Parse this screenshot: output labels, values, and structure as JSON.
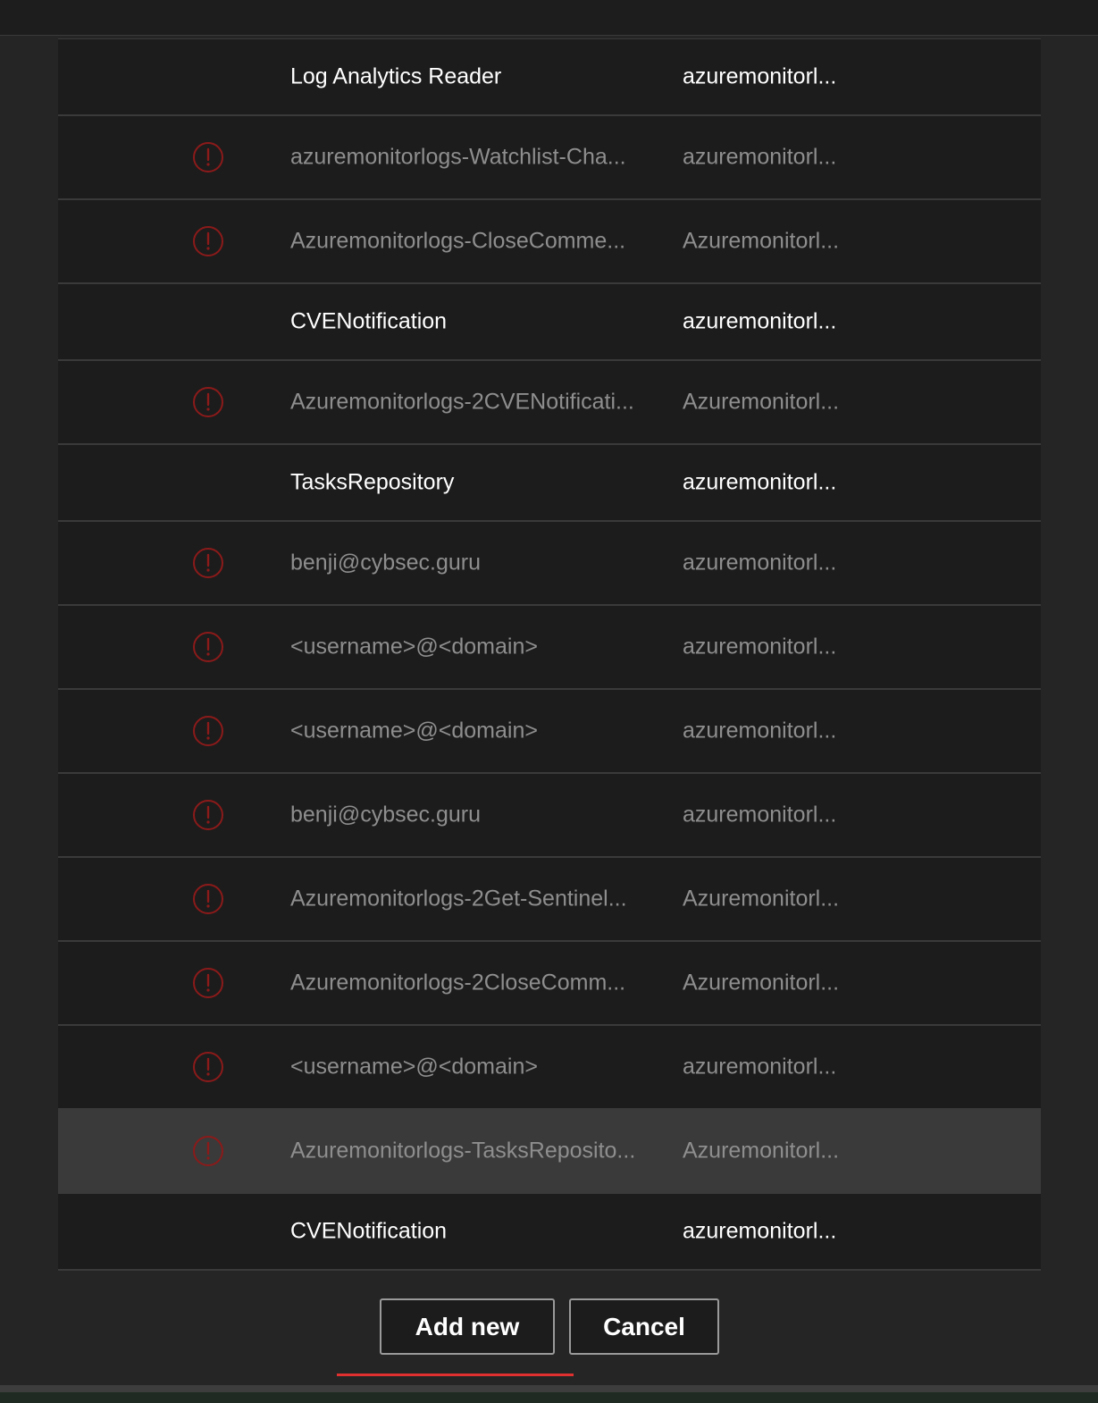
{
  "rows": [
    {
      "name": "Log Analytics Reader",
      "resource_group": "azuremonitorl...",
      "status": "active",
      "warning": false
    },
    {
      "name": "azuremonitorlogs-Watchlist-Cha...",
      "resource_group": "azuremonitorl...",
      "status": "inactive",
      "warning": true
    },
    {
      "name": "Azuremonitorlogs-CloseComme...",
      "resource_group": "Azuremonitorl...",
      "status": "inactive",
      "warning": true
    },
    {
      "name": "CVENotification",
      "resource_group": "azuremonitorl...",
      "status": "active",
      "warning": false
    },
    {
      "name": "Azuremonitorlogs-2CVENotificati...",
      "resource_group": "Azuremonitorl...",
      "status": "inactive",
      "warning": true
    },
    {
      "name": "TasksRepository",
      "resource_group": "azuremonitorl...",
      "status": "active",
      "warning": false
    },
    {
      "name": "benji@cybsec.guru",
      "resource_group": "azuremonitorl...",
      "status": "inactive",
      "warning": true
    },
    {
      "name": "<username>@<domain>",
      "resource_group": "azuremonitorl...",
      "status": "inactive",
      "warning": true
    },
    {
      "name": "<username>@<domain>",
      "resource_group": "azuremonitorl...",
      "status": "inactive",
      "warning": true
    },
    {
      "name": "benji@cybsec.guru",
      "resource_group": "azuremonitorl...",
      "status": "inactive",
      "warning": true
    },
    {
      "name": "Azuremonitorlogs-2Get-Sentinel...",
      "resource_group": "Azuremonitorl...",
      "status": "inactive",
      "warning": true
    },
    {
      "name": "Azuremonitorlogs-2CloseComm...",
      "resource_group": "Azuremonitorl...",
      "status": "inactive",
      "warning": true
    },
    {
      "name": "<username>@<domain>",
      "resource_group": "azuremonitorl...",
      "status": "inactive",
      "warning": true
    },
    {
      "name": "Azuremonitorlogs-TasksReposito...",
      "resource_group": "Azuremonitorl...",
      "status": "inactive",
      "warning": true,
      "selected": true
    },
    {
      "name": "CVENotification",
      "resource_group": "azuremonitorl...",
      "status": "active",
      "warning": false
    }
  ],
  "buttons": {
    "add_new": "Add new",
    "cancel": "Cancel"
  },
  "icons": {
    "warning": "warning-circle-icon"
  },
  "colors": {
    "warning": "#8b1a1a",
    "accent_underline": "#e03030"
  }
}
